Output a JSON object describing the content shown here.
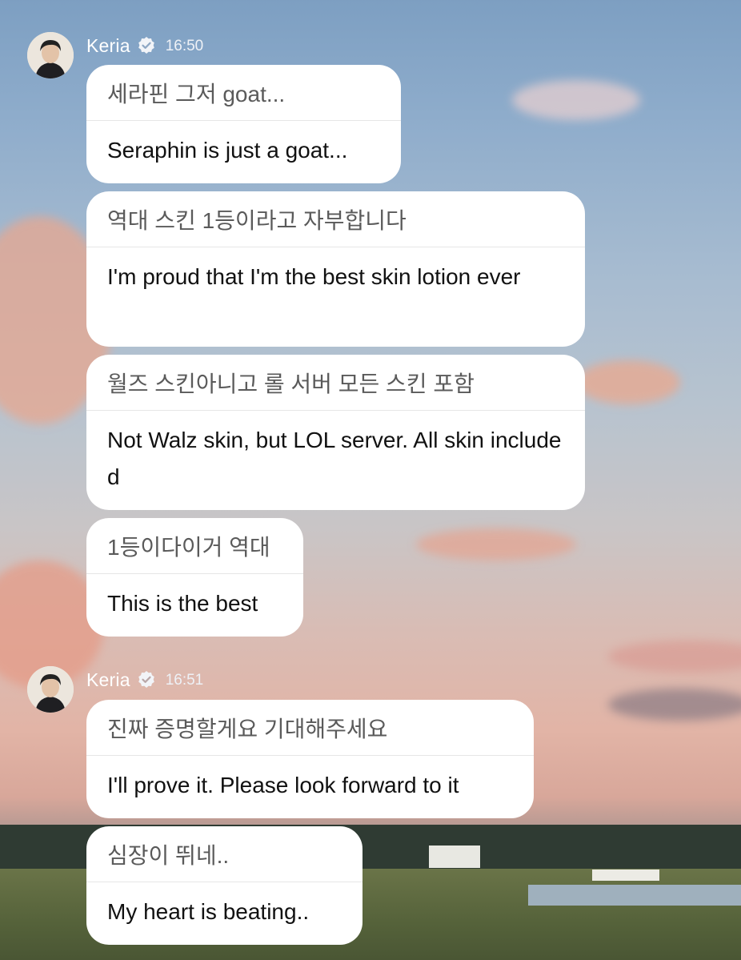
{
  "messages_groups": [
    {
      "sender": "Keria",
      "time": "16:50",
      "messages": [
        {
          "original": "세라핀 그저 goat...",
          "translation": "Seraphin is just a goat..."
        },
        {
          "original": "역대 스킨 1등이라고 자부합니다",
          "translation": "I'm proud that I'm the best skin lotion ever"
        },
        {
          "original": "월즈 스킨아니고 롤 서버 모든 스킨 포함",
          "translation": "Not Walz skin, but LOL server. All skin included"
        },
        {
          "original": "1등이다이거 역대",
          "translation": "This is the best"
        }
      ]
    },
    {
      "sender": "Keria",
      "time": "16:51",
      "messages": [
        {
          "original": "진짜 증명할게요 기대해주세요",
          "translation": "I'll prove it. Please look forward to it"
        },
        {
          "original": "심장이 뛰네..",
          "translation": "My heart is beating.."
        }
      ]
    }
  ],
  "icons": {
    "verified": "verified-check-icon",
    "avatar": "profile-avatar"
  },
  "colors": {
    "bubble": "#ffffff",
    "original_text": "#5a5a5a",
    "translation_text": "#111111",
    "sender_text": "#ffffff"
  }
}
